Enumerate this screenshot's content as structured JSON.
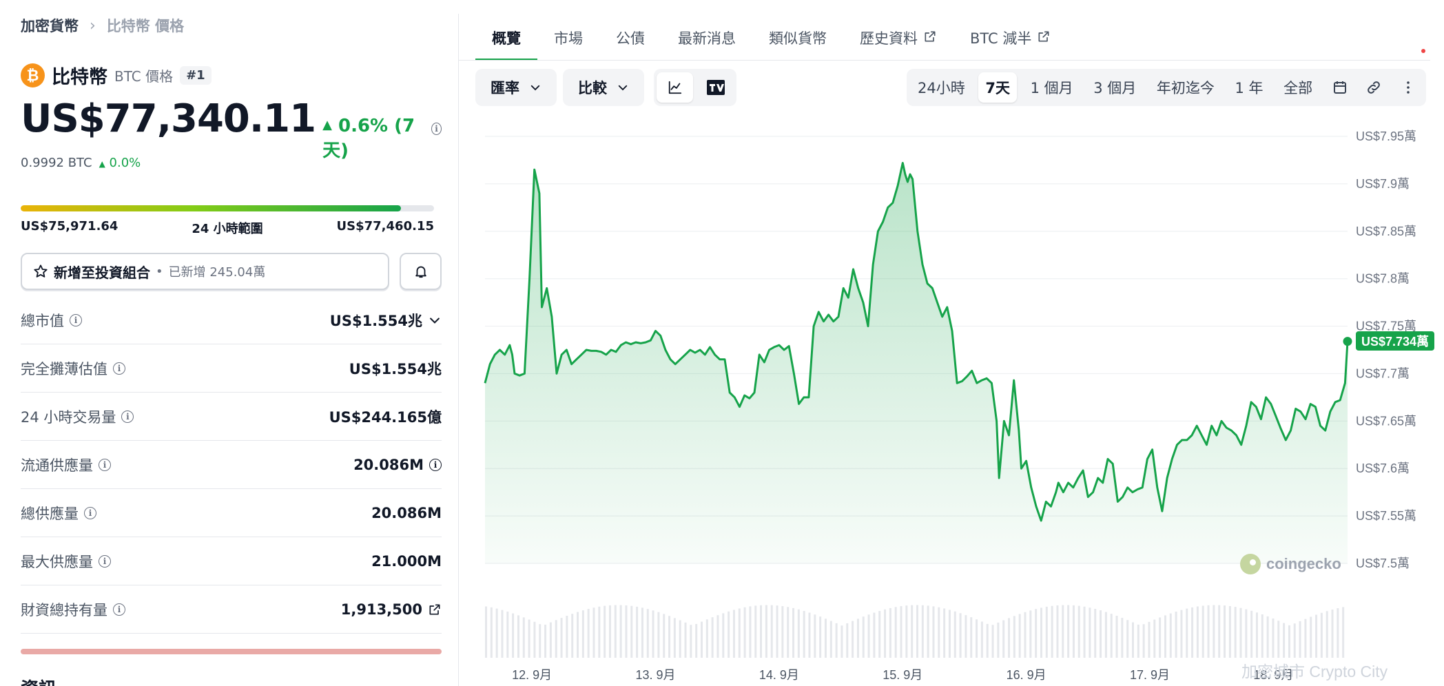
{
  "breadcrumb": {
    "root": "加密貨幣",
    "current": "比特幣 價格"
  },
  "coin": {
    "name": "比特幣",
    "symbol_label": "BTC 價格",
    "rank": "#1",
    "logo_glyph": "₿"
  },
  "price": {
    "value": "US$77,340.11",
    "change": "0.6% (7天)",
    "change_color": "#16a34a"
  },
  "btc_price": {
    "value": "0.9992 BTC",
    "change": "0.0%"
  },
  "range_24h": {
    "low": "US$75,971.64",
    "label": "24 小時範圍",
    "high": "US$77,460.15",
    "position": 0.92
  },
  "portfolio": {
    "label": "新增至投資組合",
    "added": "已新增 245.04萬"
  },
  "stats": [
    {
      "label": "總市值",
      "value": "US$1.554兆",
      "extra": "chevron-down-icon"
    },
    {
      "label": "完全攤薄估值",
      "value": "US$1.554兆"
    },
    {
      "label": "24 小時交易量",
      "value": "US$244.165億"
    },
    {
      "label": "流通供應量",
      "value": "20.086M",
      "extra": "info-icon"
    },
    {
      "label": "總供應量",
      "value": "20.086M"
    },
    {
      "label": "最大供應量",
      "value": "21.000M"
    },
    {
      "label": "財資總持有量",
      "value": "1,913,500",
      "extra": "external-link-icon"
    }
  ],
  "info_heading": "資訊",
  "tabs": [
    "概覽",
    "市場",
    "公債",
    "最新消息",
    "類似貨幣",
    "歷史資料",
    "BTC 減半"
  ],
  "controls": {
    "currency": "匯率",
    "compare": "比較"
  },
  "ranges": [
    "24小時",
    "7天",
    "1 個月",
    "3 個月",
    "年初迄今",
    "1 年",
    "全部"
  ],
  "active_range": "7天",
  "brand": "coingecko",
  "watermark": "加密城市 Crypto City",
  "accent_color": "#16a34a",
  "chart_data": {
    "type": "area",
    "y_unit": "US$ 萬",
    "ylim": [
      7.5,
      7.95
    ],
    "y_ticks": [
      "US$7.95萬",
      "US$7.9萬",
      "US$7.85萬",
      "US$7.8萬",
      "US$7.75萬",
      "US$7.7萬",
      "US$7.65萬",
      "US$7.6萬",
      "US$7.55萬",
      "US$7.5萬"
    ],
    "x_ticks": [
      "12. 9月",
      "13. 9月",
      "14. 9月",
      "15. 9月",
      "16. 9月",
      "17. 9月",
      "18. 9月"
    ],
    "x_range": [
      11.62,
      18.6
    ],
    "last_value_label": "US$7.734萬",
    "series": [
      {
        "x": [
          11.62,
          11.66,
          11.7,
          11.74,
          11.78,
          11.82,
          11.84,
          11.86,
          11.9,
          11.94,
          11.98,
          12.02,
          12.06,
          12.08,
          12.12,
          12.16,
          12.2,
          12.24,
          12.28,
          12.32,
          12.36,
          12.4,
          12.44,
          12.48,
          12.52,
          12.56,
          12.6,
          12.64,
          12.68,
          12.72,
          12.76,
          12.8,
          12.84,
          12.88,
          12.92,
          12.96,
          13.0,
          13.04,
          13.08,
          13.12,
          13.16,
          13.2,
          13.24,
          13.28,
          13.32,
          13.36,
          13.4,
          13.44,
          13.48,
          13.52,
          13.56,
          13.6,
          13.64,
          13.68,
          13.72,
          13.76,
          13.8,
          13.84,
          13.88,
          13.92,
          13.96,
          14.0,
          14.04,
          14.08,
          14.12,
          14.16,
          14.2,
          14.24,
          14.28,
          14.32,
          14.36,
          14.4,
          14.44,
          14.48,
          14.52,
          14.56,
          14.6,
          14.64,
          14.68,
          14.72,
          14.76,
          14.8,
          14.84,
          14.88,
          14.92,
          14.96,
          15.0,
          15.02,
          15.04,
          15.06,
          15.08,
          15.12,
          15.16,
          15.2,
          15.24,
          15.28,
          15.32,
          15.36,
          15.4,
          15.44,
          15.48,
          15.52,
          15.56,
          15.6,
          15.64,
          15.68,
          15.72,
          15.76,
          15.78,
          15.82,
          15.86,
          15.9,
          15.94,
          15.96,
          16.0,
          16.04,
          16.08,
          16.12,
          16.16,
          16.2,
          16.24,
          16.26,
          16.3,
          16.34,
          16.38,
          16.42,
          16.46,
          16.5,
          16.54,
          16.58,
          16.62,
          16.66,
          16.7,
          16.74,
          16.78,
          16.82,
          16.86,
          16.9,
          16.94,
          16.98,
          17.02,
          17.06,
          17.1,
          17.14,
          17.18,
          17.22,
          17.26,
          17.3,
          17.34,
          17.38,
          17.42,
          17.46,
          17.5,
          17.54,
          17.58,
          17.62,
          17.66,
          17.7,
          17.74,
          17.78,
          17.82,
          17.86,
          17.9,
          17.94,
          17.98,
          18.02,
          18.06,
          18.1,
          18.14,
          18.18,
          18.22,
          18.26,
          18.3,
          18.34,
          18.38,
          18.42,
          18.46,
          18.5,
          18.54,
          18.58,
          18.6
        ],
        "y": [
          7.69,
          7.71,
          7.72,
          7.725,
          7.72,
          7.73,
          7.72,
          7.7,
          7.698,
          7.7,
          7.8,
          7.915,
          7.89,
          7.77,
          7.79,
          7.76,
          7.7,
          7.72,
          7.725,
          7.71,
          7.715,
          7.72,
          7.725,
          7.724,
          7.724,
          7.723,
          7.72,
          7.725,
          7.723,
          7.73,
          7.733,
          7.731,
          7.733,
          7.732,
          7.733,
          7.735,
          7.745,
          7.74,
          7.725,
          7.715,
          7.71,
          7.715,
          7.72,
          7.725,
          7.722,
          7.725,
          7.72,
          7.728,
          7.72,
          7.715,
          7.715,
          7.68,
          7.675,
          7.665,
          7.677,
          7.674,
          7.68,
          7.72,
          7.712,
          7.725,
          7.728,
          7.73,
          7.725,
          7.729,
          7.7,
          7.668,
          7.675,
          7.675,
          7.75,
          7.765,
          7.755,
          7.762,
          7.755,
          7.76,
          7.79,
          7.78,
          7.81,
          7.79,
          7.775,
          7.75,
          7.815,
          7.85,
          7.86,
          7.875,
          7.88,
          7.898,
          7.922,
          7.91,
          7.902,
          7.91,
          7.905,
          7.85,
          7.815,
          7.795,
          7.79,
          7.775,
          7.76,
          7.77,
          7.745,
          7.69,
          7.692,
          7.697,
          7.703,
          7.69,
          7.693,
          7.695,
          7.69,
          7.65,
          7.59,
          7.65,
          7.635,
          7.693,
          7.64,
          7.6,
          7.608,
          7.58,
          7.56,
          7.545,
          7.565,
          7.56,
          7.575,
          7.585,
          7.575,
          7.585,
          7.58,
          7.59,
          7.598,
          7.57,
          7.575,
          7.59,
          7.585,
          7.61,
          7.605,
          7.565,
          7.57,
          7.58,
          7.575,
          7.578,
          7.58,
          7.61,
          7.62,
          7.58,
          7.555,
          7.59,
          7.61,
          7.625,
          7.63,
          7.63,
          7.635,
          7.645,
          7.635,
          7.625,
          7.645,
          7.635,
          7.65,
          7.643,
          7.64,
          7.635,
          7.625,
          7.645,
          7.67,
          7.665,
          7.652,
          7.675,
          7.668,
          7.655,
          7.642,
          7.63,
          7.64,
          7.663,
          7.66,
          7.652,
          7.668,
          7.665,
          7.645,
          7.64,
          7.66,
          7.67,
          7.672,
          7.69,
          7.734
        ]
      }
    ]
  }
}
